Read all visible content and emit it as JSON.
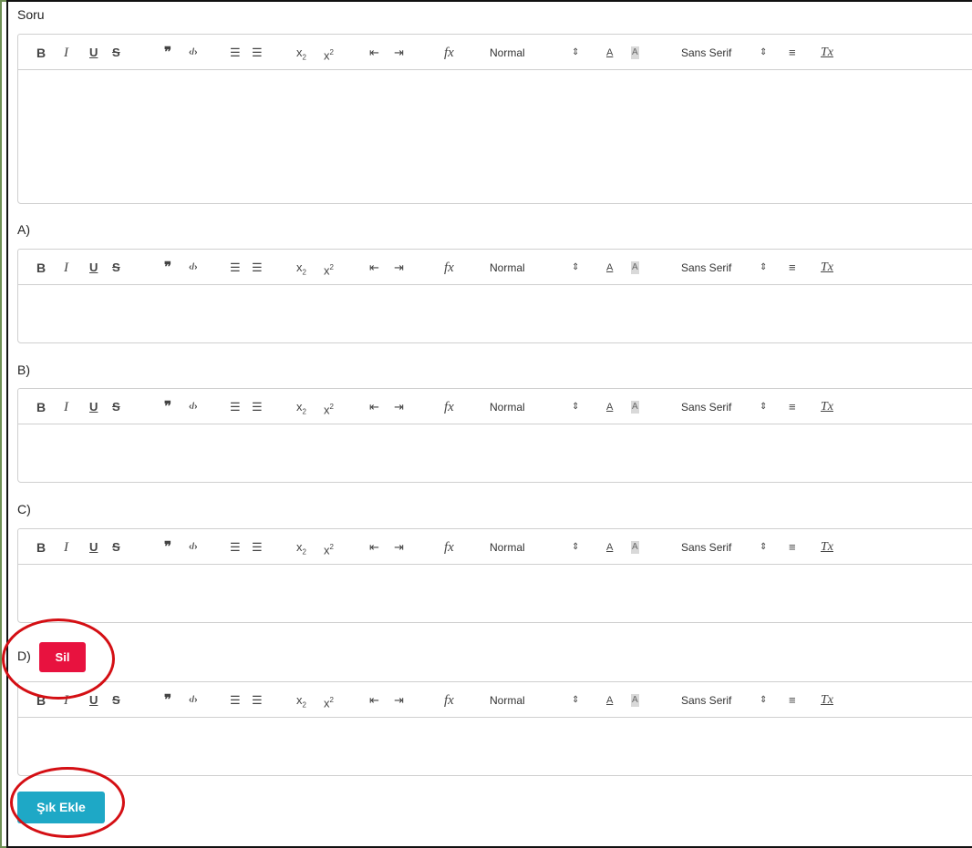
{
  "labels": {
    "question": "Soru",
    "option_a": "A)",
    "option_b": "B)",
    "option_c": "C)",
    "option_d": "D)"
  },
  "toolbar": {
    "bold": "B",
    "italic": "I",
    "underline": "U",
    "strike": "S",
    "blockquote": "❞",
    "code": "‹/›",
    "ordered_list": "☰",
    "bullet_list": "☰",
    "subscript": "x",
    "subscript_mark": "2",
    "superscript": "x",
    "superscript_mark": "2",
    "outdent": "⇤",
    "indent": "⇥",
    "formula": "fx",
    "size_value": "Normal",
    "select_arrow": "⇕",
    "font_color": "A",
    "background_color": "A",
    "font_value": "Sans Serif",
    "align": "≡",
    "clean": "Tx"
  },
  "buttons": {
    "delete": "Sil",
    "add_option": "Şık Ekle"
  },
  "colors": {
    "delete_button": "#e8123f",
    "add_button": "#1ea8c6",
    "highlight_circle": "#d40f14"
  }
}
